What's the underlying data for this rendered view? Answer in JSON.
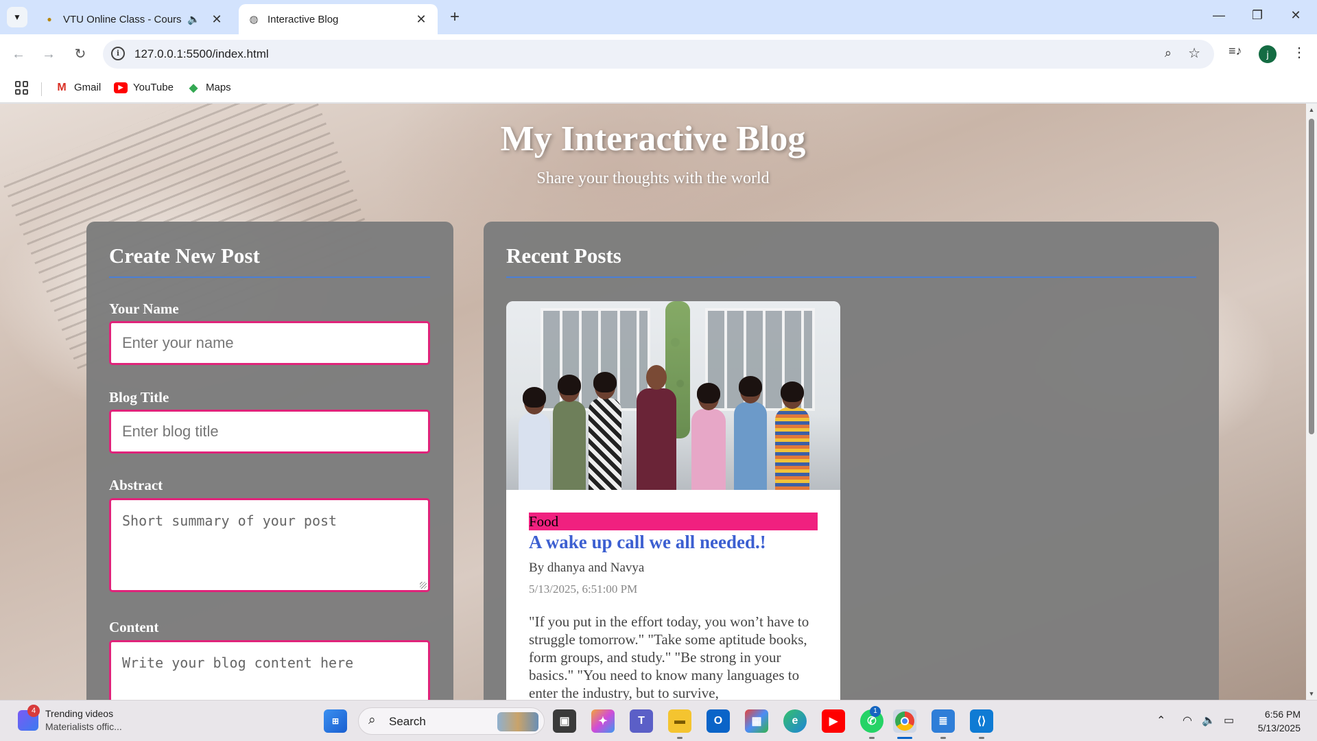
{
  "browser": {
    "tabs": [
      {
        "title": "VTU Online Class - Course",
        "active": false,
        "audio": true
      },
      {
        "title": "Interactive Blog",
        "active": true
      }
    ],
    "url": "127.0.0.1:5500/index.html",
    "profile_initial": "j",
    "bookmarks": [
      {
        "label": "Gmail",
        "icon": "gmail-icon"
      },
      {
        "label": "YouTube",
        "icon": "youtube-icon"
      },
      {
        "label": "Maps",
        "icon": "maps-icon"
      }
    ]
  },
  "page": {
    "title": "My Interactive Blog",
    "subtitle": "Share your thoughts with the world",
    "create": {
      "heading": "Create New Post",
      "name_label": "Your Name",
      "name_placeholder": "Enter your name",
      "title_label": "Blog Title",
      "title_placeholder": "Enter blog title",
      "abstract_label": "Abstract",
      "abstract_placeholder": "Short summary of your post",
      "content_label": "Content",
      "content_placeholder": "Write your blog content here"
    },
    "recent": {
      "heading": "Recent Posts",
      "posts": [
        {
          "category": "Food",
          "title": "A wake up call we all needed.!",
          "author": "By dhanya and Navya",
          "date": "5/13/2025, 6:51:00 PM",
          "body": "\"If you put in the effort today, you won’t have to struggle tomorrow.\" \"Take some aptitude books, form groups, and study.\" \"Be strong in your basics.\" \"You need to know many languages to enter the industry, but to survive,"
        }
      ]
    }
  },
  "taskbar": {
    "widget_badge": "4",
    "widget_title": "Trending videos",
    "widget_subtitle": "Materialists offic...",
    "search_label": "Search",
    "whatsapp_badge": "1",
    "time": "6:56 PM",
    "date": "5/13/2025"
  },
  "colors": {
    "accent_border": "#e0237a",
    "category_bg": "#f0207f",
    "post_title": "#3c5fd1",
    "rule": "#4a7fd6"
  }
}
